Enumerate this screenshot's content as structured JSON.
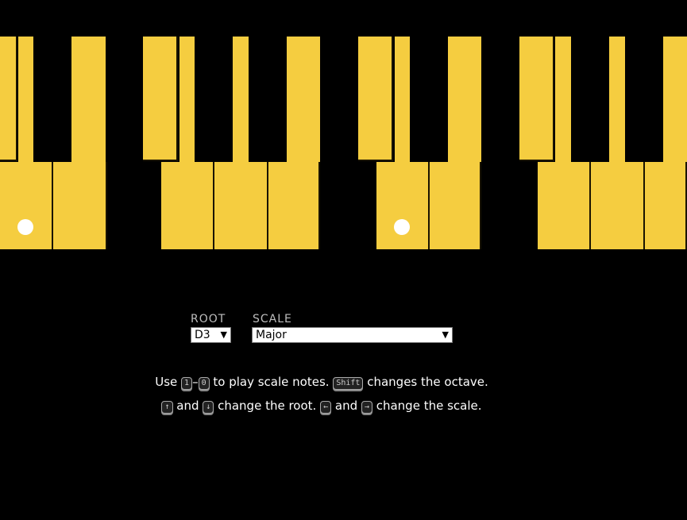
{
  "piano": {
    "key_color": "#f5cd40",
    "marker_color": "#ffffff",
    "root_markers": [
      "D",
      "D"
    ]
  },
  "root": {
    "label": "ROOT",
    "value": "D3"
  },
  "scale": {
    "label": "SCALE",
    "value": "Major"
  },
  "help": {
    "line1": {
      "use": "Use",
      "key1": "1",
      "dash": "–",
      "key0": "0",
      "play": "to play scale notes.",
      "shift": "Shift",
      "octave": "changes the octave."
    },
    "line2": {
      "up": "↑",
      "and1": "and",
      "down": "↓",
      "root": "change the root.",
      "left": "←",
      "and2": "and",
      "right": "→",
      "scale": "change the scale."
    }
  }
}
